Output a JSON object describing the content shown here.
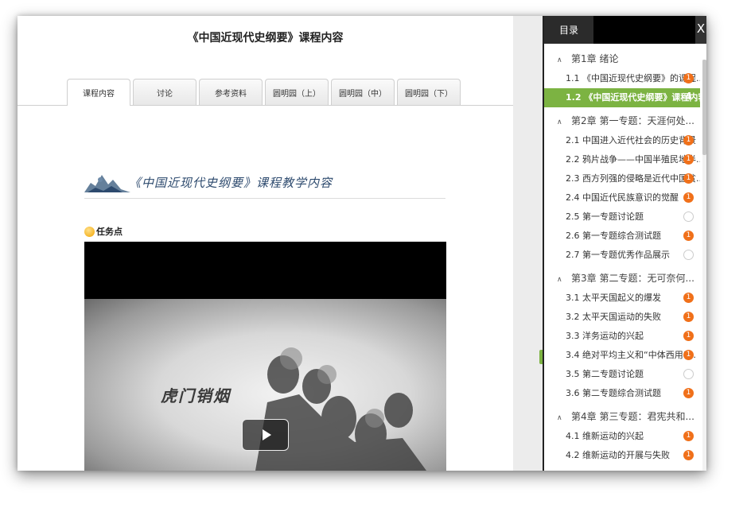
{
  "page": {
    "title": "《中国近现代史纲要》课程内容"
  },
  "tabs": [
    {
      "label": "课程内容"
    },
    {
      "label": "讨论"
    },
    {
      "label": "参考资料"
    },
    {
      "label": "圆明园（上）"
    },
    {
      "label": "圆明园（中）"
    },
    {
      "label": "圆明园（下）"
    }
  ],
  "banner": {
    "title": "《中国近现代史纲要》课程教学内容"
  },
  "task": {
    "label": "任务点"
  },
  "video": {
    "caption": "虎门销烟"
  },
  "sidebar": {
    "tab_label": "目录",
    "close": "X",
    "chapters": [
      {
        "title": "第1章 绪论",
        "lessons": [
          {
            "label": "1.1 《中国近现代史纲要》的课程...",
            "badge": "1"
          },
          {
            "label": "1.2 《中国近现代史纲要》课程内容",
            "badge": "4"
          }
        ]
      },
      {
        "title": "第2章 第一专题：天涯何处...",
        "lessons": [
          {
            "label": "2.1 中国进入近代社会的历史背景",
            "badge": "1"
          },
          {
            "label": "2.2 鸦片战争——中国半殖民地半...",
            "badge": "1"
          },
          {
            "label": "2.3 西方列强的侵略是近代中国贫...",
            "badge": "1"
          },
          {
            "label": "2.4 中国近代民族意识的觉醒",
            "badge": "1"
          },
          {
            "label": "2.5 第一专题讨论题",
            "badge": ""
          },
          {
            "label": "2.6 第一专题综合测试题",
            "badge": "1"
          },
          {
            "label": "2.7 第一专题优秀作品展示",
            "badge": ""
          }
        ]
      },
      {
        "title": "第3章 第二专题：无可奈何...",
        "lessons": [
          {
            "label": "3.1 太平天国起义的爆发",
            "badge": "1"
          },
          {
            "label": "3.2 太平天国运动的失败",
            "badge": "1"
          },
          {
            "label": "3.3 洋务运动的兴起",
            "badge": "1"
          },
          {
            "label": "3.4 绝对平均主义和“中体西用”...",
            "badge": "1"
          },
          {
            "label": "3.5 第二专题讨论题",
            "badge": ""
          },
          {
            "label": "3.6 第二专题综合测试题",
            "badge": "1"
          }
        ]
      },
      {
        "title": "第4章 第三专题：君宪共和...",
        "lessons": [
          {
            "label": "4.1 维新运动的兴起",
            "badge": "1"
          },
          {
            "label": "4.2 维新运动的开展与失败",
            "badge": "1"
          }
        ]
      }
    ]
  },
  "colors": {
    "accent": "#7cb342",
    "badge": "#f0701a",
    "sidebar_header": "#000000"
  }
}
